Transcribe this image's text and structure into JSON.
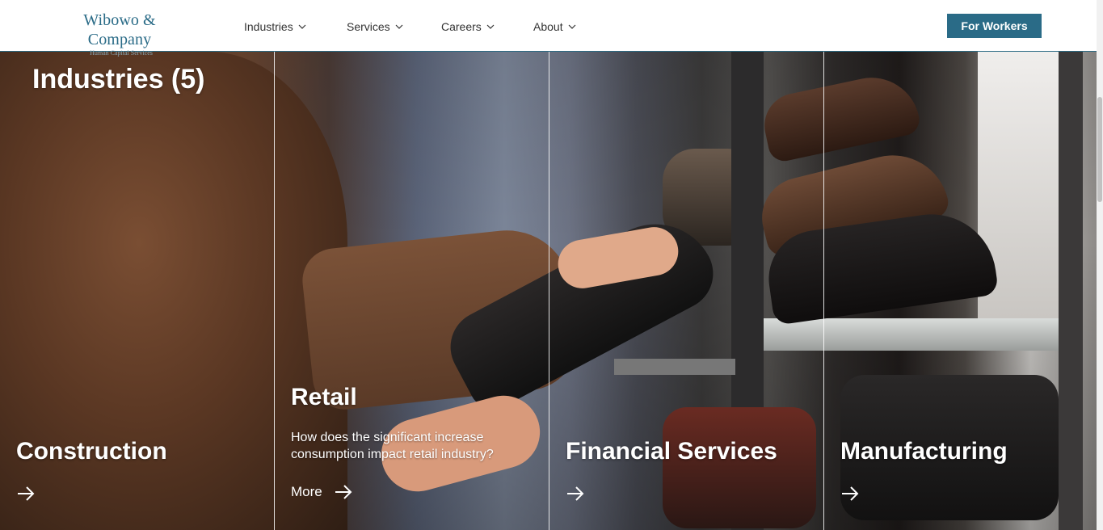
{
  "header": {
    "logo_name": "Wibowo & Company",
    "logo_tagline": "Human Capital Services",
    "nav": [
      {
        "label": "Industries",
        "icon": "chevron-down-icon"
      },
      {
        "label": "Services",
        "icon": "chevron-down-icon"
      },
      {
        "label": "Careers",
        "icon": "chevron-down-icon"
      },
      {
        "label": "About",
        "icon": "chevron-down-icon"
      }
    ],
    "cta_label": "For Workers"
  },
  "hero": {
    "title": "Industries (5)",
    "cards": [
      {
        "title": "Construction",
        "icon": "arrow-right-icon"
      },
      {
        "title": "Retail",
        "description": "How does the significant increase consumption impact retail industry?",
        "link_label": "More",
        "icon": "arrow-right-icon"
      },
      {
        "title": "Financial Services",
        "icon": "arrow-right-icon"
      },
      {
        "title": "Manufacturing",
        "icon": "arrow-right-icon"
      }
    ]
  },
  "colors": {
    "brand": "#2a6b87",
    "text_on_image": "#ffffff"
  }
}
